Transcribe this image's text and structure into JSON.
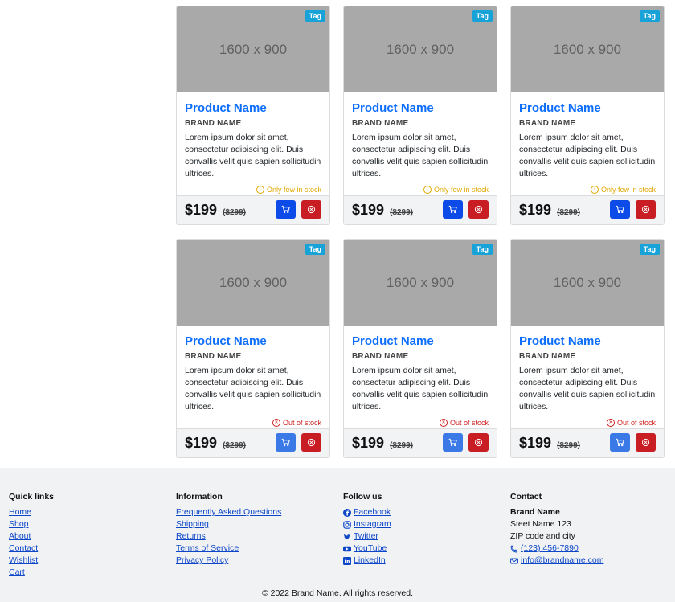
{
  "products": [
    {
      "img": "1600 x 900",
      "tag": "Tag",
      "name": "Product Name",
      "brand": "BRAND NAME",
      "desc": "Lorem ipsum dolor sit amet, consectetur adipiscing elit. Duis convallis velit quis sapien sollicitudin ultrices.",
      "stock": "Only few in stock",
      "price": "$199",
      "old": "($299)"
    },
    {
      "img": "1600 x 900",
      "tag": "Tag",
      "name": "Product Name",
      "brand": "BRAND NAME",
      "desc": "Lorem ipsum dolor sit amet, consectetur adipiscing elit. Duis convallis velit quis sapien sollicitudin ultrices.",
      "stock": "Only few in stock",
      "price": "$199",
      "old": "($299)"
    },
    {
      "img": "1600 x 900",
      "tag": "Tag",
      "name": "Product Name",
      "brand": "BRAND NAME",
      "desc": "Lorem ipsum dolor sit amet, consectetur adipiscing elit. Duis convallis velit quis sapien sollicitudin ultrices.",
      "stock": "Only few in stock",
      "price": "$199",
      "old": "($299)"
    },
    {
      "img": "1600 x 900",
      "tag": "Tag",
      "name": "Product Name",
      "brand": "BRAND NAME",
      "desc": "Lorem ipsum dolor sit amet, consectetur adipiscing elit. Duis convallis velit quis sapien sollicitudin ultrices.",
      "stock": "Out of stock",
      "price": "$199",
      "old": "($299)"
    },
    {
      "img": "1600 x 900",
      "tag": "Tag",
      "name": "Product Name",
      "brand": "BRAND NAME",
      "desc": "Lorem ipsum dolor sit amet, consectetur adipiscing elit. Duis convallis velit quis sapien sollicitudin ultrices.",
      "stock": "Out of stock",
      "price": "$199",
      "old": "($299)"
    },
    {
      "img": "1600 x 900",
      "tag": "Tag",
      "name": "Product Name",
      "brand": "BRAND NAME",
      "desc": "Lorem ipsum dolor sit amet, consectetur adipiscing elit. Duis convallis velit quis sapien sollicitudin ultrices.",
      "stock": "Out of stock",
      "price": "$199",
      "old": "($299)"
    }
  ],
  "icons": {
    "cart": "cart-icon",
    "remove": "remove-icon",
    "info": "info-icon",
    "out": "x-circle-icon"
  },
  "colors": {
    "few_stock": "#e0a800",
    "out_stock": "#d01f1f",
    "cart_button": "#0d4be8",
    "remove_button": "#c91d24",
    "tag": "#17a2d8"
  },
  "footer": {
    "quick_links": {
      "title": "Quick links",
      "items": [
        "Home",
        "Shop",
        "About",
        "Contact",
        "Wishlist",
        "Cart"
      ]
    },
    "information": {
      "title": "Information",
      "items": [
        "Frequently Asked Questions",
        "Shipping",
        "Returns",
        "Terms of Service",
        "Privacy Policy"
      ]
    },
    "follow": {
      "title": "Follow us",
      "items": [
        "Facebook",
        "Instagram",
        "Twitter",
        "YouTube",
        "LinkedIn"
      ]
    },
    "contact": {
      "title": "Contact",
      "brand": "Brand Name",
      "street": "Steet Name 123",
      "zip": "ZIP code and city",
      "phone": "(123) 456-7890",
      "email": "info@brandname.com"
    },
    "copyright": "© 2022 Brand Name. All rights reserved."
  }
}
